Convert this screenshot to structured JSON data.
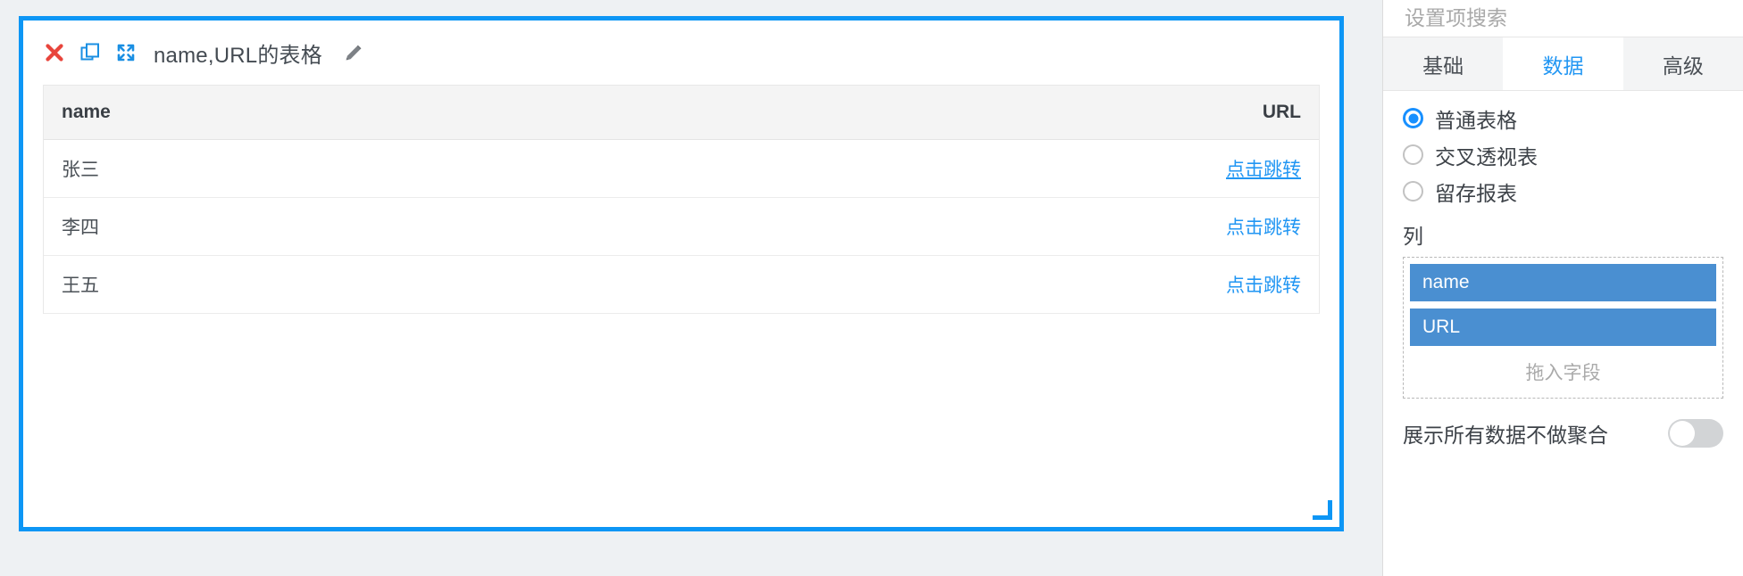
{
  "widget": {
    "title": "name,URL的表格",
    "toolbar_icons": [
      {
        "name": "close-icon",
        "label": "×"
      },
      {
        "name": "duplicate-icon",
        "label": "⧉"
      },
      {
        "name": "move-icon",
        "label": "⤢"
      }
    ],
    "edit_icon": "pencil-icon",
    "resize_handle": "resize-handle"
  },
  "table": {
    "columns": [
      {
        "key": "name",
        "label": "name",
        "align": "left"
      },
      {
        "key": "url",
        "label": "URL",
        "align": "right"
      }
    ],
    "rows": [
      {
        "name": "张三",
        "url_text": "点击跳转",
        "underlined": true
      },
      {
        "name": "李四",
        "url_text": "点击跳转",
        "underlined": false
      },
      {
        "name": "王五",
        "url_text": "点击跳转",
        "underlined": false
      }
    ]
  },
  "sidebar": {
    "search": {
      "placeholder": "设置项搜索",
      "value": ""
    },
    "tabs": [
      {
        "label": "基础",
        "active": false
      },
      {
        "label": "数据",
        "active": true
      },
      {
        "label": "高级",
        "active": false
      }
    ],
    "radios": [
      {
        "label": "普通表格",
        "checked": true
      },
      {
        "label": "交叉透视表",
        "checked": false
      },
      {
        "label": "留存报表",
        "checked": false
      }
    ],
    "columns_section": {
      "label": "列",
      "chips": [
        "name",
        "URL"
      ],
      "drop_hint": "拖入字段"
    },
    "aggregate_toggle": {
      "label": "展示所有数据不做聚合",
      "on": false
    }
  },
  "colors": {
    "accent": "#0d96f5",
    "link": "#2196f3",
    "chip": "#4a8fd1",
    "close": "#e8453c",
    "page_bg": "#eef1f3"
  }
}
